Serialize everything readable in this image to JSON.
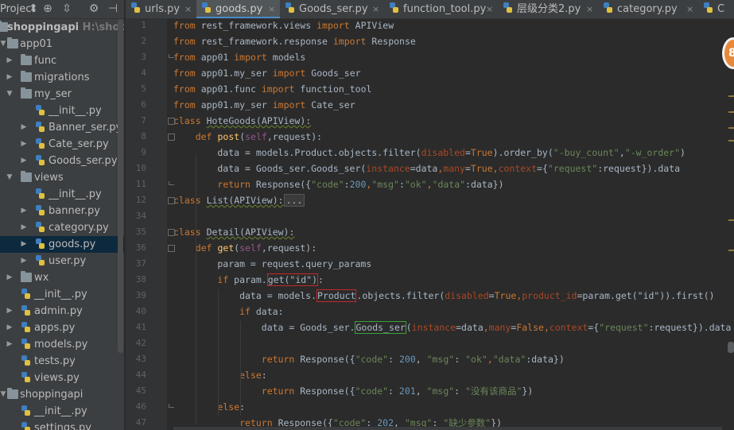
{
  "toolbar": {
    "project_label": "Project",
    "icons": [
      "dropdown-icon",
      "target-icon",
      "collapse-icon",
      "gear-icon",
      "hide-icon"
    ]
  },
  "tree": [
    {
      "label": "shoppingapi",
      "sub": "H:\\shopping",
      "level": 0,
      "type": "folder",
      "expanded": true,
      "bold": true
    },
    {
      "label": "app01",
      "level": 0,
      "type": "folder",
      "expanded": true
    },
    {
      "label": "func",
      "level": 1,
      "type": "folder",
      "expanded": false
    },
    {
      "label": "migrations",
      "level": 1,
      "type": "folder",
      "expanded": false
    },
    {
      "label": "my_ser",
      "level": 1,
      "type": "folder",
      "expanded": true
    },
    {
      "label": "__init__.py",
      "level": 2,
      "type": "py",
      "expanded": null
    },
    {
      "label": "Banner_ser.py",
      "level": 2,
      "type": "py",
      "expanded": false
    },
    {
      "label": "Cate_ser.py",
      "level": 2,
      "type": "py",
      "expanded": false
    },
    {
      "label": "Goods_ser.py",
      "level": 2,
      "type": "py",
      "expanded": false
    },
    {
      "label": "views",
      "level": 1,
      "type": "folder",
      "expanded": true
    },
    {
      "label": "__init__.py",
      "level": 2,
      "type": "py",
      "expanded": null
    },
    {
      "label": "banner.py",
      "level": 2,
      "type": "py",
      "expanded": false
    },
    {
      "label": "category.py",
      "level": 2,
      "type": "py",
      "expanded": false
    },
    {
      "label": "goods.py",
      "level": 2,
      "type": "py",
      "expanded": false,
      "selected": true
    },
    {
      "label": "user.py",
      "level": 2,
      "type": "py",
      "expanded": false
    },
    {
      "label": "wx",
      "level": 1,
      "type": "folder",
      "expanded": false
    },
    {
      "label": "__init__.py",
      "level": 1,
      "type": "py",
      "expanded": null
    },
    {
      "label": "admin.py",
      "level": 1,
      "type": "py",
      "expanded": false
    },
    {
      "label": "apps.py",
      "level": 1,
      "type": "py",
      "expanded": false
    },
    {
      "label": "models.py",
      "level": 1,
      "type": "py",
      "expanded": false
    },
    {
      "label": "tests.py",
      "level": 1,
      "type": "py",
      "expanded": null
    },
    {
      "label": "views.py",
      "level": 1,
      "type": "py",
      "expanded": null
    },
    {
      "label": "shoppingapi",
      "level": 0,
      "type": "folder",
      "expanded": true
    },
    {
      "label": "__init__.py",
      "level": 1,
      "type": "py",
      "expanded": null
    },
    {
      "label": "settings.py",
      "level": 1,
      "type": "py",
      "expanded": null
    }
  ],
  "tabs": [
    {
      "label": "urls.py",
      "close": "×",
      "active": false
    },
    {
      "label": "goods.py",
      "close": "×",
      "active": true
    },
    {
      "label": "Goods_ser.py",
      "close": "×",
      "active": false
    },
    {
      "label": "function_tool.py",
      "close": "×",
      "active": false
    },
    {
      "label": "层级分类2.py",
      "close": "×",
      "active": false
    },
    {
      "label": "category.py",
      "close": "×",
      "active": false
    },
    {
      "label": "C",
      "close": "",
      "active": false
    }
  ],
  "notification_badge": "8",
  "colors": {
    "background": "#2b2b2b",
    "keyword": "#cc7832",
    "function": "#ffc66d",
    "string": "#6a8759",
    "number": "#6897bb",
    "param": "#aa4926",
    "self": "#94558d",
    "highlight_red": "#c82828",
    "highlight_green": "#3aa33a",
    "tab_underline": "#4a88c7"
  },
  "code_lines": [
    {
      "n": "1",
      "tokens": [
        [
          "kw",
          "from"
        ],
        [
          "",
          "rest_framework.views "
        ],
        [
          "kw",
          "import"
        ],
        [
          "",
          "APIView"
        ]
      ]
    },
    {
      "n": "2",
      "tokens": [
        [
          "kw",
          "from"
        ],
        [
          "",
          "rest_framework.response "
        ],
        [
          "kw",
          "import"
        ],
        [
          "",
          "Response"
        ]
      ]
    },
    {
      "n": "3",
      "tokens": [
        [
          "kw",
          "from"
        ],
        [
          "",
          "app01 "
        ],
        [
          "kw",
          "import"
        ],
        [
          "",
          "models"
        ]
      ]
    },
    {
      "n": "4",
      "tokens": [
        [
          "kw",
          "from"
        ],
        [
          "",
          "app01.my_ser "
        ],
        [
          "kw",
          "import"
        ],
        [
          "",
          "Goods_ser"
        ]
      ]
    },
    {
      "n": "5",
      "tokens": [
        [
          "kw",
          "from"
        ],
        [
          "",
          "app01.func "
        ],
        [
          "kw",
          "import"
        ],
        [
          "",
          "function_tool"
        ]
      ]
    },
    {
      "n": "6",
      "tokens": [
        [
          "kw",
          "from"
        ],
        [
          "",
          "app01.my_ser "
        ],
        [
          "kw",
          "import"
        ],
        [
          "",
          "Cate_ser"
        ]
      ]
    },
    {
      "n": "7",
      "tokens": [
        [
          "kw",
          "class"
        ],
        [
          "cls-decl",
          "HoteGoods(APIView):"
        ]
      ]
    },
    {
      "n": "8",
      "tokens": [
        [
          "",
          "    "
        ],
        [
          "kw",
          "def"
        ],
        [
          "fn",
          "post"
        ],
        [
          "",
          "("
        ],
        [
          "sf",
          "self"
        ],
        [
          "",
          ","
        ],
        [
          "",
          "request):"
        ]
      ]
    },
    {
      "n": "9",
      "tokens": [
        [
          "",
          "        data = models.Product.objects.filter("
        ],
        [
          "pa",
          "disabled"
        ],
        [
          "",
          "="
        ],
        [
          "kw",
          "True"
        ],
        [
          "",
          ").order_by("
        ],
        [
          "st",
          "\"-buy_count\""
        ],
        [
          "",
          ","
        ],
        [
          "st",
          "\"-w_order\""
        ],
        [
          "",
          ")"
        ]
      ]
    },
    {
      "n": "10",
      "tokens": [
        [
          "",
          "        data = Goods_ser.Goods_ser("
        ],
        [
          "pa",
          "instance"
        ],
        [
          "",
          "=data"
        ],
        [
          "kw",
          ","
        ],
        [
          "pa",
          "many"
        ],
        [
          "",
          "="
        ],
        [
          "kw",
          "True"
        ],
        [
          "kw",
          ","
        ],
        [
          "pa",
          "context"
        ],
        [
          "",
          "={"
        ],
        [
          "st",
          "\"request\""
        ],
        [
          "",
          ":request}).data"
        ]
      ]
    },
    {
      "n": "11",
      "tokens": [
        [
          "",
          "        "
        ],
        [
          "kw",
          "return"
        ],
        [
          "",
          " Response({"
        ],
        [
          "st",
          "\"code\""
        ],
        [
          "",
          ":"
        ],
        [
          "nu",
          "200"
        ],
        [
          "kw",
          ","
        ],
        [
          "st",
          "\"msg\""
        ],
        [
          "",
          ":"
        ],
        [
          "st",
          "\"ok\""
        ],
        [
          "kw",
          ","
        ],
        [
          "st",
          "\"data\""
        ],
        [
          "",
          ":data})"
        ]
      ]
    },
    {
      "n": "12",
      "tokens": [
        [
          "kw",
          "class"
        ],
        [
          "cls-decl",
          "List(APIView):"
        ],
        [
          "collapsed",
          "..."
        ]
      ]
    },
    {
      "n": "34",
      "tokens": []
    },
    {
      "n": "35",
      "tokens": [
        [
          "kw",
          "class"
        ],
        [
          "cls-decl",
          "Detail(APIView):"
        ]
      ]
    },
    {
      "n": "36",
      "tokens": [
        [
          "",
          "    "
        ],
        [
          "kw",
          "def"
        ],
        [
          "fn",
          "get"
        ],
        [
          "",
          "("
        ],
        [
          "sf",
          "self"
        ],
        [
          "",
          ","
        ],
        [
          "",
          "request):"
        ]
      ]
    },
    {
      "n": "37",
      "tokens": [
        [
          "",
          "        param = request.query_params"
        ]
      ]
    },
    {
      "n": "38",
      "tokens": [
        [
          "",
          "        "
        ],
        [
          "kw",
          "if"
        ],
        [
          "",
          " param."
        ],
        [
          "hl",
          "get(\"id\")"
        ],
        [
          "",
          ":"
        ]
      ]
    },
    {
      "n": "39",
      "tokens": [
        [
          "",
          "            data = models."
        ],
        [
          "hl",
          "Product"
        ],
        [
          "",
          ".objects.filter("
        ],
        [
          "pa",
          "disabled"
        ],
        [
          "",
          "="
        ],
        [
          "kw",
          "True"
        ],
        [
          "kw",
          ","
        ],
        [
          "pa",
          "product_id"
        ],
        [
          "",
          "=param.get(\"id\")).first()"
        ]
      ]
    },
    {
      "n": "40",
      "tokens": [
        [
          "",
          "            "
        ],
        [
          "kw",
          "if"
        ],
        [
          "",
          " data:"
        ]
      ]
    },
    {
      "n": "41",
      "tokens": [
        [
          "",
          "                data = Goods_ser."
        ],
        [
          "hl-green",
          "Goods_ser"
        ],
        [
          "",
          "("
        ],
        [
          "pa",
          "instance"
        ],
        [
          "",
          "=data"
        ],
        [
          "kw",
          ","
        ],
        [
          "pa",
          "many"
        ],
        [
          "",
          "="
        ],
        [
          "kw",
          "False"
        ],
        [
          "kw",
          ","
        ],
        [
          "pa",
          "context"
        ],
        [
          "",
          "={"
        ],
        [
          "st",
          "\"request\""
        ],
        [
          "",
          ":request}).data"
        ]
      ]
    },
    {
      "n": "42",
      "tokens": []
    },
    {
      "n": "43",
      "tokens": [
        [
          "",
          "                "
        ],
        [
          "kw",
          "return"
        ],
        [
          "",
          ""
        ],
        [
          "",
          "Response({"
        ],
        [
          "st",
          "\"code\""
        ],
        [
          "",
          ": "
        ],
        [
          "nu",
          "200"
        ],
        [
          "",
          ", "
        ],
        [
          "st",
          "\"msg\""
        ],
        [
          "",
          ": "
        ],
        [
          "st",
          "\"ok\""
        ],
        [
          "kw",
          ","
        ],
        [
          "st",
          "\"data\""
        ],
        [
          "",
          ":data})"
        ]
      ]
    },
    {
      "n": "44",
      "tokens": [
        [
          "",
          "            "
        ],
        [
          "kw",
          "else"
        ],
        [
          "",
          ":"
        ]
      ]
    },
    {
      "n": "45",
      "tokens": [
        [
          "",
          "                "
        ],
        [
          "kw",
          "return"
        ],
        [
          "",
          " Response({"
        ],
        [
          "st",
          "\"code\""
        ],
        [
          "",
          ": "
        ],
        [
          "nu",
          "201"
        ],
        [
          "",
          ", "
        ],
        [
          "st",
          "\"msg\""
        ],
        [
          "",
          ": "
        ],
        [
          "st",
          "\"没有该商品\""
        ],
        [
          "",
          "})"
        ]
      ]
    },
    {
      "n": "46",
      "tokens": [
        [
          "",
          "        "
        ],
        [
          "kw",
          "else"
        ],
        [
          "",
          ":"
        ]
      ]
    },
    {
      "n": "47",
      "tokens": [
        [
          "",
          "            "
        ],
        [
          "kw",
          "return"
        ],
        [
          "",
          " Response({"
        ],
        [
          "st",
          "\"code\""
        ],
        [
          "",
          ": "
        ],
        [
          "nu",
          "202"
        ],
        [
          "",
          ", "
        ],
        [
          "st",
          "\"msg\""
        ],
        [
          "",
          ": "
        ],
        [
          "st",
          "\"缺少参数\""
        ],
        [
          "",
          "})"
        ]
      ]
    }
  ]
}
